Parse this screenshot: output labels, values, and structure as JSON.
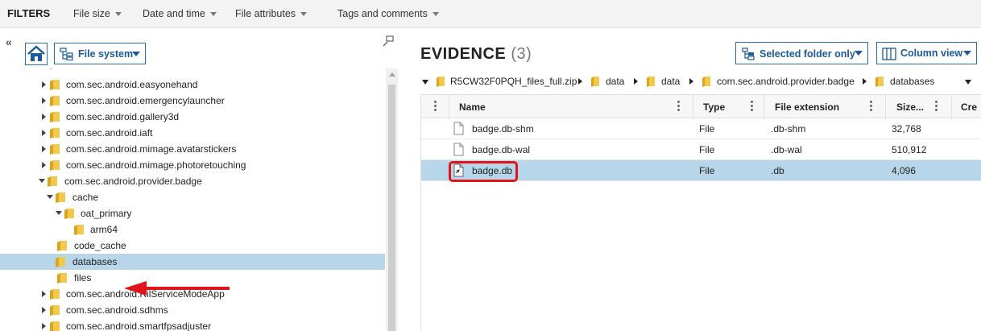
{
  "filters": {
    "title": "FILTERS",
    "items": [
      "File size",
      "Date and time",
      "File attributes",
      "Tags and comments"
    ]
  },
  "left": {
    "collapse_glyph": "«",
    "view_selector": "File system",
    "tree": [
      {
        "label": "com.sec.android.easyonehand",
        "expanded": false
      },
      {
        "label": "com.sec.android.emergencylauncher",
        "expanded": false
      },
      {
        "label": "com.sec.android.gallery3d",
        "expanded": false
      },
      {
        "label": "com.sec.android.iaft",
        "expanded": false
      },
      {
        "label": "com.sec.android.mimage.avatarstickers",
        "expanded": false
      },
      {
        "label": "com.sec.android.mimage.photoretouching",
        "expanded": false
      },
      {
        "label": "com.sec.android.provider.badge",
        "expanded": true
      },
      {
        "label": "cache",
        "expanded": true
      },
      {
        "label": "oat_primary",
        "expanded": true
      },
      {
        "label": "arm64",
        "expanded": false
      },
      {
        "label": "code_cache",
        "expanded": false
      },
      {
        "label": "databases",
        "selected": true
      },
      {
        "label": "files",
        "expanded": false
      },
      {
        "label": "com.sec.android.RilServiceModeApp",
        "expanded": false
      },
      {
        "label": "com.sec.android.sdhms",
        "expanded": false
      },
      {
        "label": "com.sec.android.smartfpsadjuster",
        "expanded": false
      }
    ]
  },
  "right": {
    "title": "EVIDENCE",
    "count": "(3)",
    "folder_scope": "Selected folder only",
    "view_mode": "Column view",
    "path": [
      "R5CW32F0PQH_files_full.zip",
      "data",
      "data",
      "com.sec.android.provider.badge",
      "databases"
    ],
    "columns": [
      "Name",
      "Type",
      "File extension",
      "Size...",
      "Cre"
    ],
    "rows": [
      {
        "name": "badge.db-shm",
        "type": "File",
        "ext": ".db-shm",
        "size": "32,768"
      },
      {
        "name": "badge.db-wal",
        "type": "File",
        "ext": ".db-wal",
        "size": "510,912"
      },
      {
        "name": "badge.db",
        "type": "File",
        "ext": ".db",
        "size": "4,096",
        "selected": true
      }
    ]
  },
  "colors": {
    "accent": "#2a6cae",
    "selection": "#b8d6ea",
    "highlight_red": "#e0141b",
    "folder_yellow": "#f2c94c"
  },
  "icons": [
    "home-icon",
    "tree-icon",
    "pin-icon",
    "folder-icon",
    "file-icon",
    "link-file-icon",
    "column-view-icon"
  ]
}
